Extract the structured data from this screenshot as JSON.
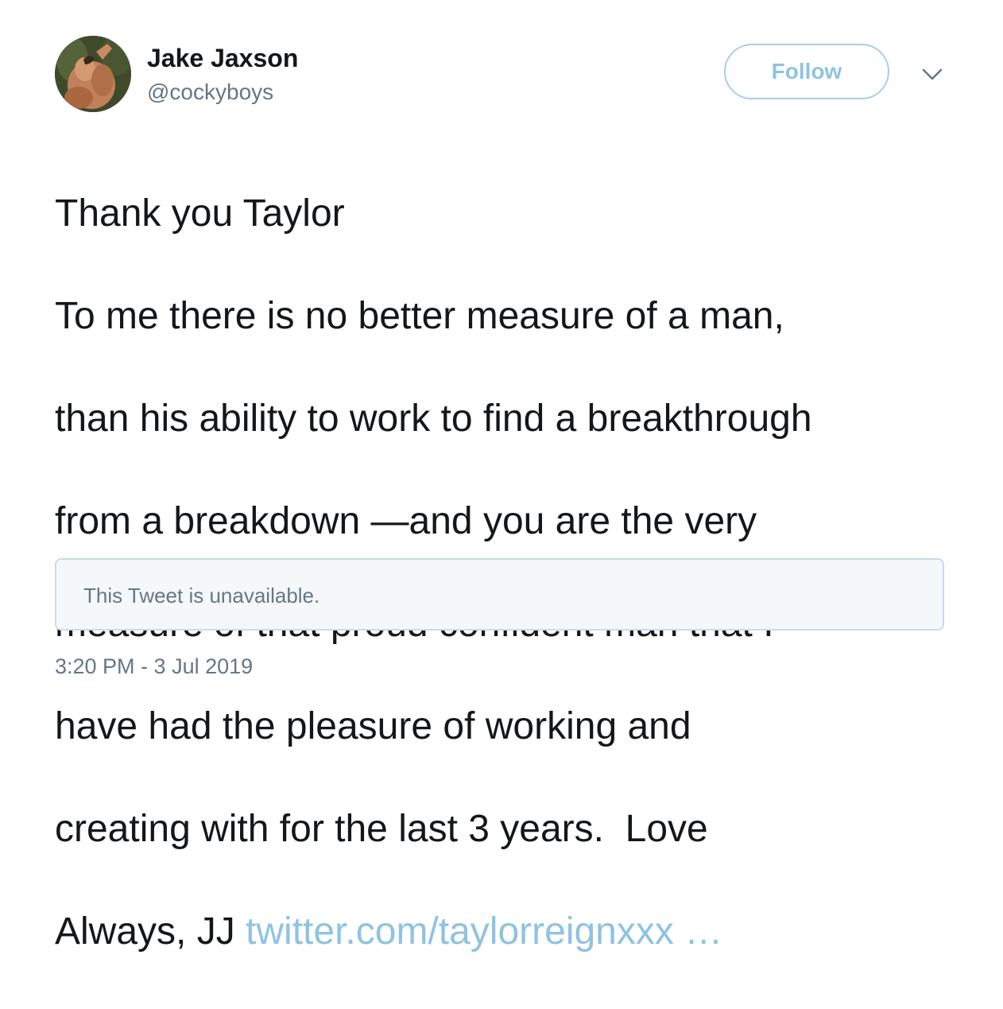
{
  "author": {
    "display_name": "Jake Jaxson",
    "handle": "@cockyboys",
    "avatar_icon": "profile-photo"
  },
  "follow_button": {
    "label": "Follow",
    "color": "#8ec3e2"
  },
  "menu": {
    "icon": "chevron-down-icon"
  },
  "tweet": {
    "lines": [
      "Thank you Taylor",
      "To me there is no better measure of a man,",
      "than his ability to work to find a breakthrough",
      "from a breakdown —and you are the very",
      "measure of that proud confident man that I",
      "have had the pleasure of working and",
      "creating with for the last 3 years.  Love"
    ],
    "last_line_text": "Always, JJ ",
    "link_text": "twitter.com/taylorreignxxx …",
    "link_color": "#8ec3e2"
  },
  "quoted_tweet": {
    "text": "This Tweet is unavailable."
  },
  "timestamp": "3:20 PM - 3 Jul 2019"
}
